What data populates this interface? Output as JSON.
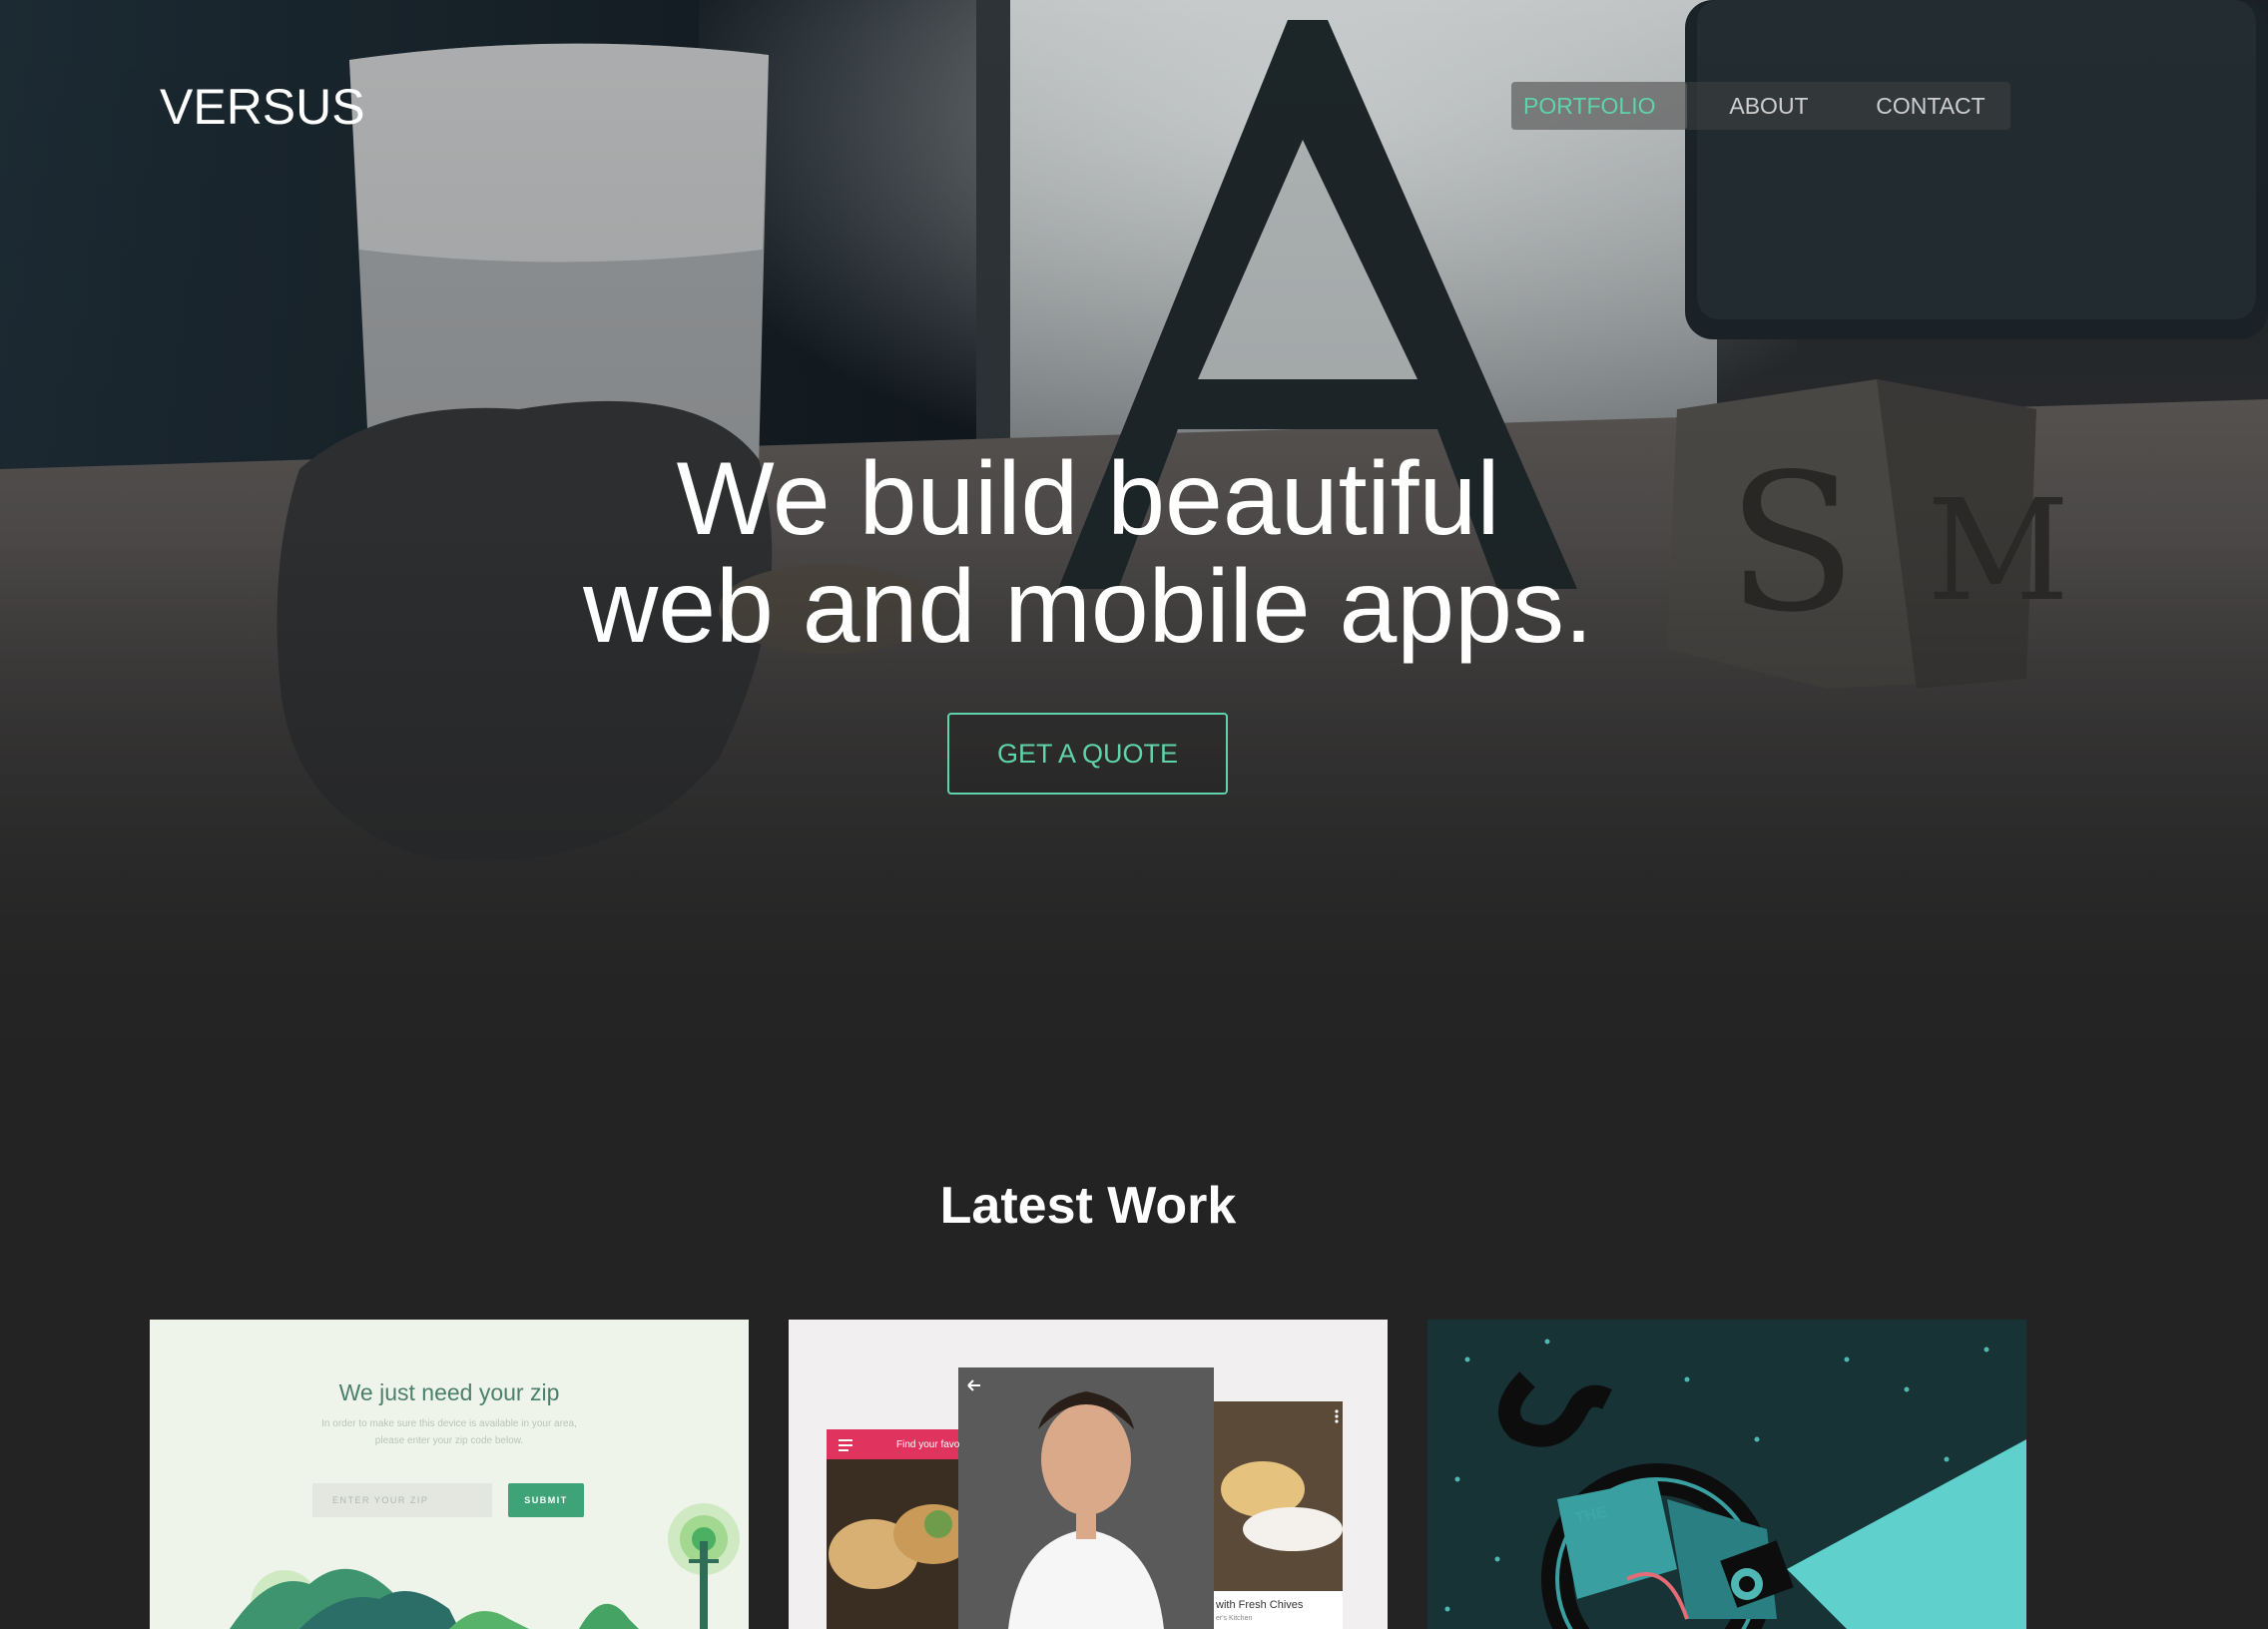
{
  "brand": {
    "name": "VERSUS"
  },
  "nav": {
    "items": [
      {
        "label": "PORTFOLIO",
        "active": true
      },
      {
        "label": "ABOUT",
        "active": false
      },
      {
        "label": "CONTACT",
        "active": false
      }
    ]
  },
  "hero": {
    "headline_line1": "We build beautiful",
    "headline_line2": "web and mobile apps.",
    "cta_label": "GET A QUOTE"
  },
  "latest_work": {
    "title": "Latest Work",
    "cards": [
      {
        "heading": "We just need your zip",
        "subtext_line1": "In order to make sure this device is available in your area,",
        "subtext_line2": "please enter your zip code below.",
        "input_placeholder": "ENTER YOUR ZIP",
        "submit_label": "SUBMIT"
      },
      {
        "find_label": "Find your favo",
        "caption": "with Fresh Chives",
        "caption_sub": "er's Kitchen"
      },
      {
        "sign_text": "THE"
      }
    ]
  },
  "colors": {
    "accent": "#5fd3a9",
    "background": "#232323",
    "card1_bg": "#eff4ea",
    "card3_bg": "#173335",
    "submit_green": "#3ea477"
  },
  "icons": [
    "hamburger-icon",
    "back-arrow-icon",
    "more-vert-icon"
  ]
}
